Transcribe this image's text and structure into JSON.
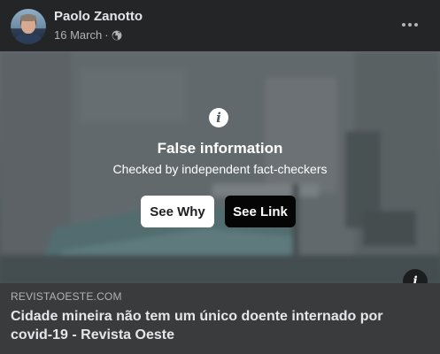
{
  "post": {
    "author": "Paolo Zanotto",
    "date": "16 March",
    "separator": "·",
    "privacy_icon": "globe-icon",
    "more_icon": "more-options-icon"
  },
  "warning": {
    "icon": "info-icon",
    "title": "False information",
    "subtitle": "Checked by independent fact-checkers",
    "see_why_label": "See Why",
    "see_link_label": "See Link"
  },
  "link_preview": {
    "domain": "REVISTAOESTE.COM",
    "headline": "Cidade mineira não tem um único doente internado por covid-19 - Revista Oeste"
  },
  "colors": {
    "background": "#242526",
    "preview_background": "#3a3b3c",
    "primary_text": "#e4e6eb",
    "secondary_text": "#b0b3b8",
    "see_why_bg": "#ffffff",
    "see_link_bg": "#050505"
  }
}
